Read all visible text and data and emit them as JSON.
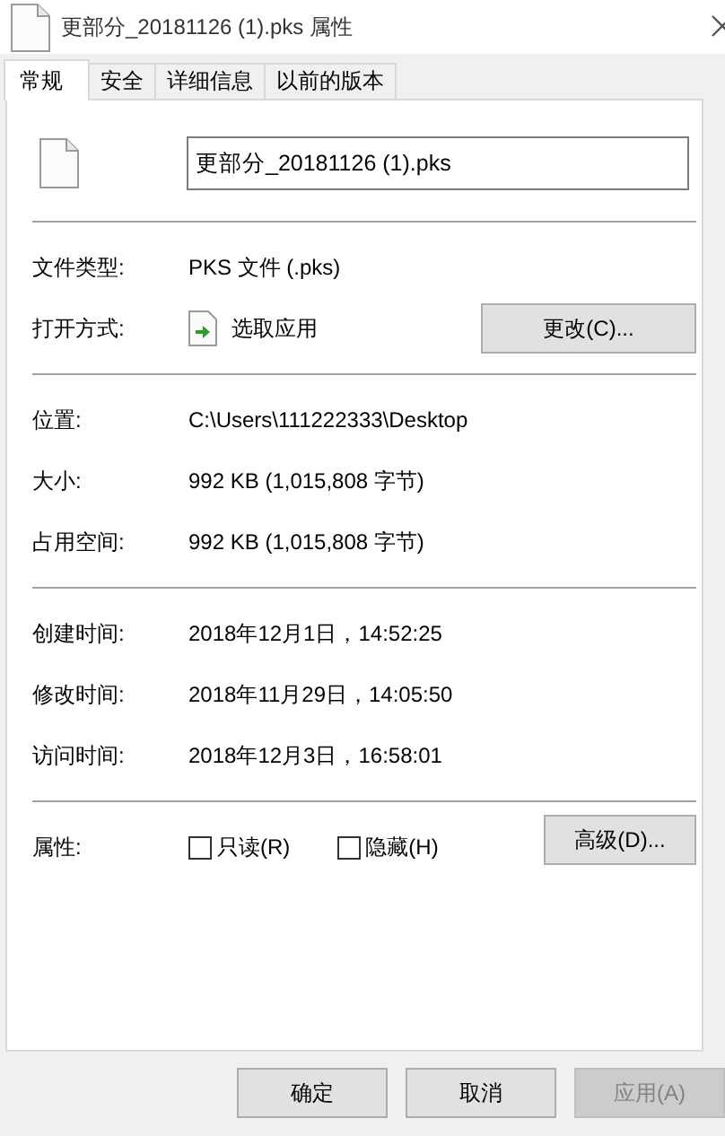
{
  "window": {
    "title": "更部分_20181126 (1).pks 属性"
  },
  "tabs": [
    {
      "label": "常规",
      "selected": true
    },
    {
      "label": "安全",
      "selected": false
    },
    {
      "label": "详细信息",
      "selected": false
    },
    {
      "label": "以前的版本",
      "selected": false
    }
  ],
  "file_name": {
    "value": "更部分_20181126 (1).pks"
  },
  "sections": [
    {
      "rows": [
        {
          "kind": "text",
          "label": "文件类型:",
          "value": "PKS 文件 (.pks)"
        },
        {
          "kind": "app",
          "label": "打开方式:",
          "value": "选取应用",
          "button": "更改(C)..."
        }
      ]
    },
    {
      "rows": [
        {
          "kind": "text",
          "label": "位置:",
          "value": "C:\\Users\\111222333\\Desktop"
        },
        {
          "kind": "text",
          "label": "大小:",
          "value": "992 KB (1,015,808 字节)"
        },
        {
          "kind": "text",
          "label": "占用空间:",
          "value": "992 KB (1,015,808 字节)"
        }
      ]
    },
    {
      "rows": [
        {
          "kind": "text",
          "label": "创建时间:",
          "value": "2018年12月1日，14:52:25"
        },
        {
          "kind": "text",
          "label": "修改时间:",
          "value": "2018年11月29日，14:05:50"
        },
        {
          "kind": "text",
          "label": "访问时间:",
          "value": "2018年12月3日，16:58:01"
        }
      ]
    },
    {
      "rows": [
        {
          "kind": "attributes",
          "label": "属性:",
          "checkboxes": [
            {
              "label": "只读(R)",
              "checked": false
            },
            {
              "label": "隐藏(H)",
              "checked": false
            }
          ],
          "button": "高级(D)..."
        }
      ]
    }
  ],
  "buttons": [
    {
      "label": "确定",
      "disabled": false
    },
    {
      "label": "取消",
      "disabled": false
    },
    {
      "label": "应用(A)",
      "disabled": true
    }
  ]
}
